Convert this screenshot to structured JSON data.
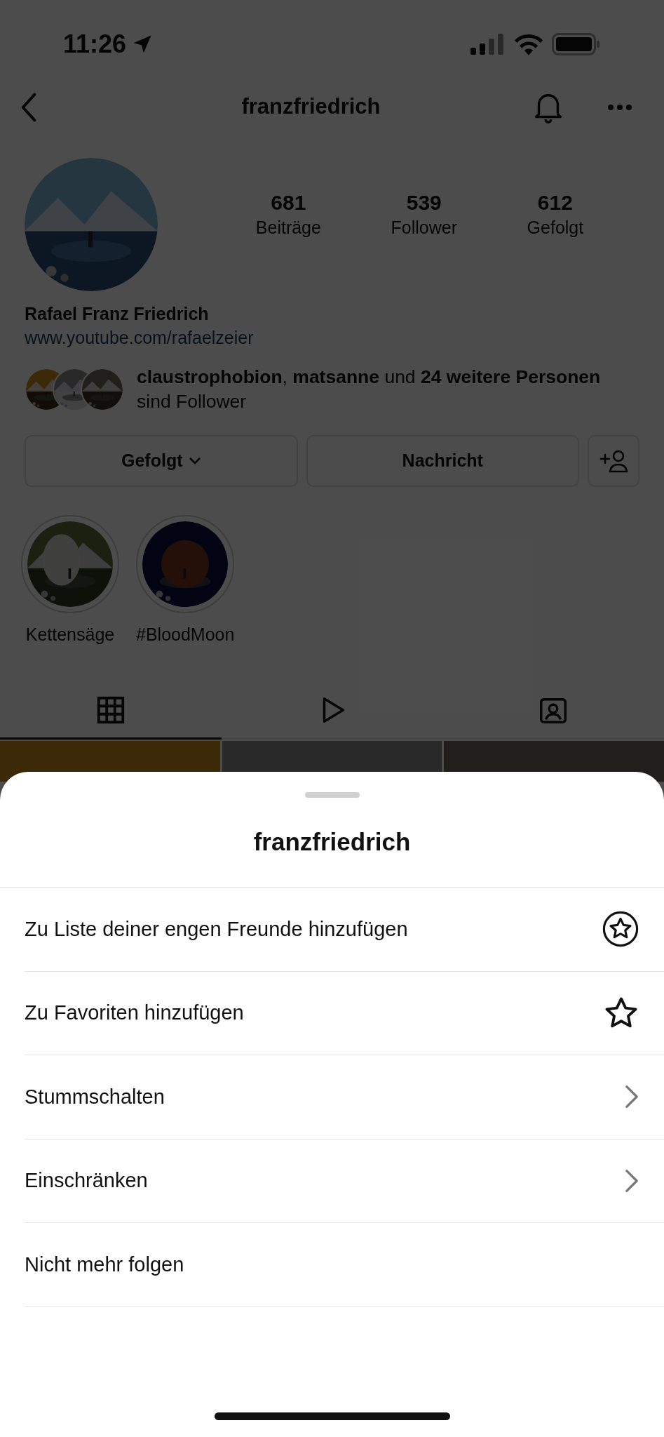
{
  "status_bar": {
    "time": "11:26"
  },
  "header": {
    "username": "franzfriedrich"
  },
  "profile": {
    "stats": [
      {
        "value": "681",
        "label": "Beiträge"
      },
      {
        "value": "539",
        "label": "Follower"
      },
      {
        "value": "612",
        "label": "Gefolgt"
      }
    ],
    "name": "Rafael Franz Friedrich",
    "link": "www.youtube.com/rafaelzeier",
    "followed_by": {
      "text": "**claustrophobion**, **matsanne** und **24 weitere Personen** sind Follower"
    }
  },
  "actions": [
    {
      "kind": "dropdown",
      "label": "Gefolgt"
    },
    {
      "kind": "text",
      "label": "Nachricht"
    },
    {
      "kind": "add_person"
    }
  ],
  "highlights": [
    {
      "label": "Kettensäge",
      "kind": "picture"
    },
    {
      "label": "#BloodMoon",
      "kind": "picture"
    }
  ],
  "tabs": [
    {
      "kind": "grid",
      "selected": true
    },
    {
      "kind": "reels",
      "selected": false
    },
    {
      "kind": "tagged",
      "selected": false
    }
  ],
  "sheet": {
    "title": "franzfriedrich",
    "items": [
      {
        "label": "Zu Liste deiner engen Freunde hinzufügen",
        "kind": "circle_star"
      },
      {
        "label": "Zu Favoriten hinzufügen",
        "kind": "star"
      },
      {
        "label": "Stummschalten",
        "kind": "chevron"
      },
      {
        "label": "Einschränken",
        "kind": "chevron"
      },
      {
        "label": "Nicht mehr folgen",
        "kind": "plain"
      }
    ]
  }
}
